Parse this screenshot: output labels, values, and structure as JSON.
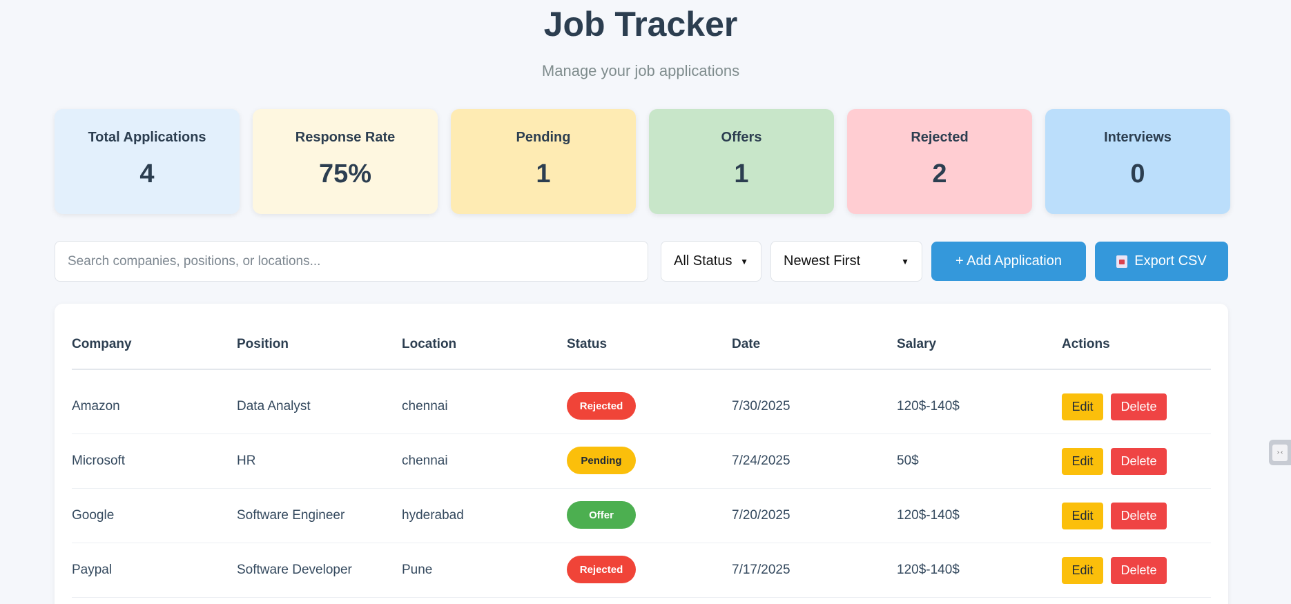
{
  "header": {
    "title": "Job Tracker",
    "subtitle": "Manage your job applications"
  },
  "stats": [
    {
      "label": "Total Applications",
      "value": "4",
      "color": "#e3f0fc"
    },
    {
      "label": "Response Rate",
      "value": "75%",
      "color": "#fef7e0"
    },
    {
      "label": "Pending",
      "value": "1",
      "color": "#feebb3"
    },
    {
      "label": "Offers",
      "value": "1",
      "color": "#c8e6c9"
    },
    {
      "label": "Rejected",
      "value": "2",
      "color": "#ffcdd2"
    },
    {
      "label": "Interviews",
      "value": "0",
      "color": "#bbdefb"
    }
  ],
  "controls": {
    "search_placeholder": "Search companies, positions, or locations...",
    "status_filter": "All Status",
    "sort": "Newest First",
    "add_label": "+ Add Application",
    "export_label": "Export CSV",
    "export_icon": "inbox-tray-icon"
  },
  "table": {
    "columns": [
      "Company",
      "Position",
      "Location",
      "Status",
      "Date",
      "Salary",
      "Actions"
    ],
    "edit_label": "Edit",
    "delete_label": "Delete",
    "rows": [
      {
        "company": "Amazon",
        "position": "Data Analyst",
        "location": "chennai",
        "status": "Rejected",
        "date": "7/30/2025",
        "salary": "120$-140$"
      },
      {
        "company": "Microsoft",
        "position": "HR",
        "location": "chennai",
        "status": "Pending",
        "date": "7/24/2025",
        "salary": "50$"
      },
      {
        "company": "Google",
        "position": "Software Engineer",
        "location": "hyderabad",
        "status": "Offer",
        "date": "7/20/2025",
        "salary": "120$-140$"
      },
      {
        "company": "Paypal",
        "position": "Software Developer",
        "location": "Pune",
        "status": "Rejected",
        "date": "7/17/2025",
        "salary": "120$-140$"
      }
    ]
  },
  "colors": {
    "primary": "#3498db",
    "rejected": "#f04438",
    "pending": "#fbbf0b",
    "offer": "#4caf50",
    "delete": "#ef4444"
  },
  "side_widget": {
    "icon": "collapse-panel-icon",
    "glyph": "›‹"
  }
}
